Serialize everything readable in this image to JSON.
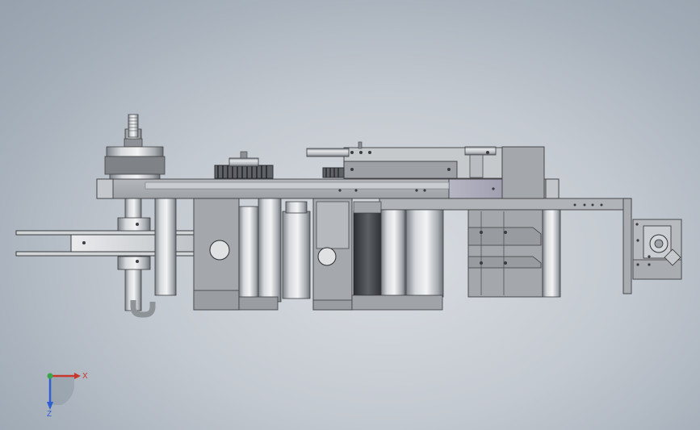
{
  "window": {
    "title": ""
  },
  "viewport": {
    "background_top": "#9aa6b2",
    "background_center": "#d9dde2"
  },
  "triad": {
    "x_label": "X",
    "z_label": "Z",
    "x_color": "#c8372e",
    "y_color": "#3aa64a",
    "z_color": "#2f5fd0"
  },
  "icons": [
    "coordinate-triad-icon"
  ]
}
